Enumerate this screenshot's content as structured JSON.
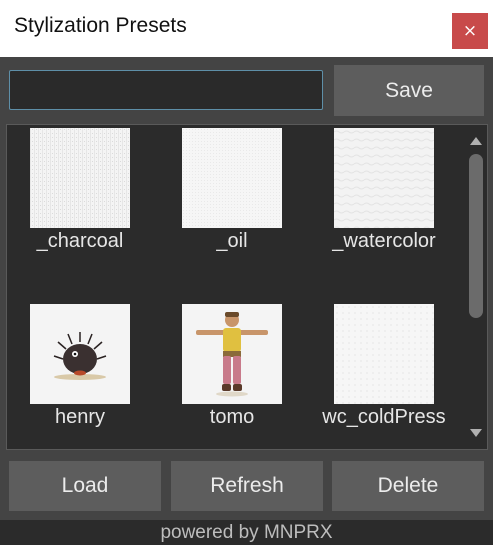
{
  "window": {
    "title": "Stylization Presets",
    "close_label": "×"
  },
  "name_input": {
    "value": "",
    "placeholder": ""
  },
  "buttons": {
    "save": "Save",
    "load": "Load",
    "refresh": "Refresh",
    "delete": "Delete"
  },
  "presets": [
    {
      "label": "_charcoal",
      "thumbnail": "charcoal-paper-texture"
    },
    {
      "label": "_oil",
      "thumbnail": "oil-canvas-texture"
    },
    {
      "label": "_watercolor",
      "thumbnail": "watercolor-paper-texture"
    },
    {
      "label": "henry",
      "thumbnail": "henry-hedgehog-render"
    },
    {
      "label": "tomo",
      "thumbnail": "tomo-character-render"
    },
    {
      "label": "wc_coldPress",
      "thumbnail": "cold-press-paper-texture"
    }
  ],
  "footer": {
    "text": "powered by MNPRX"
  },
  "colors": {
    "window_bg": "#444444",
    "panel_bg": "#2b2b2b",
    "button_bg": "#5d5d5d",
    "close_bg": "#c84a4a",
    "input_border": "#5e8fa8"
  }
}
